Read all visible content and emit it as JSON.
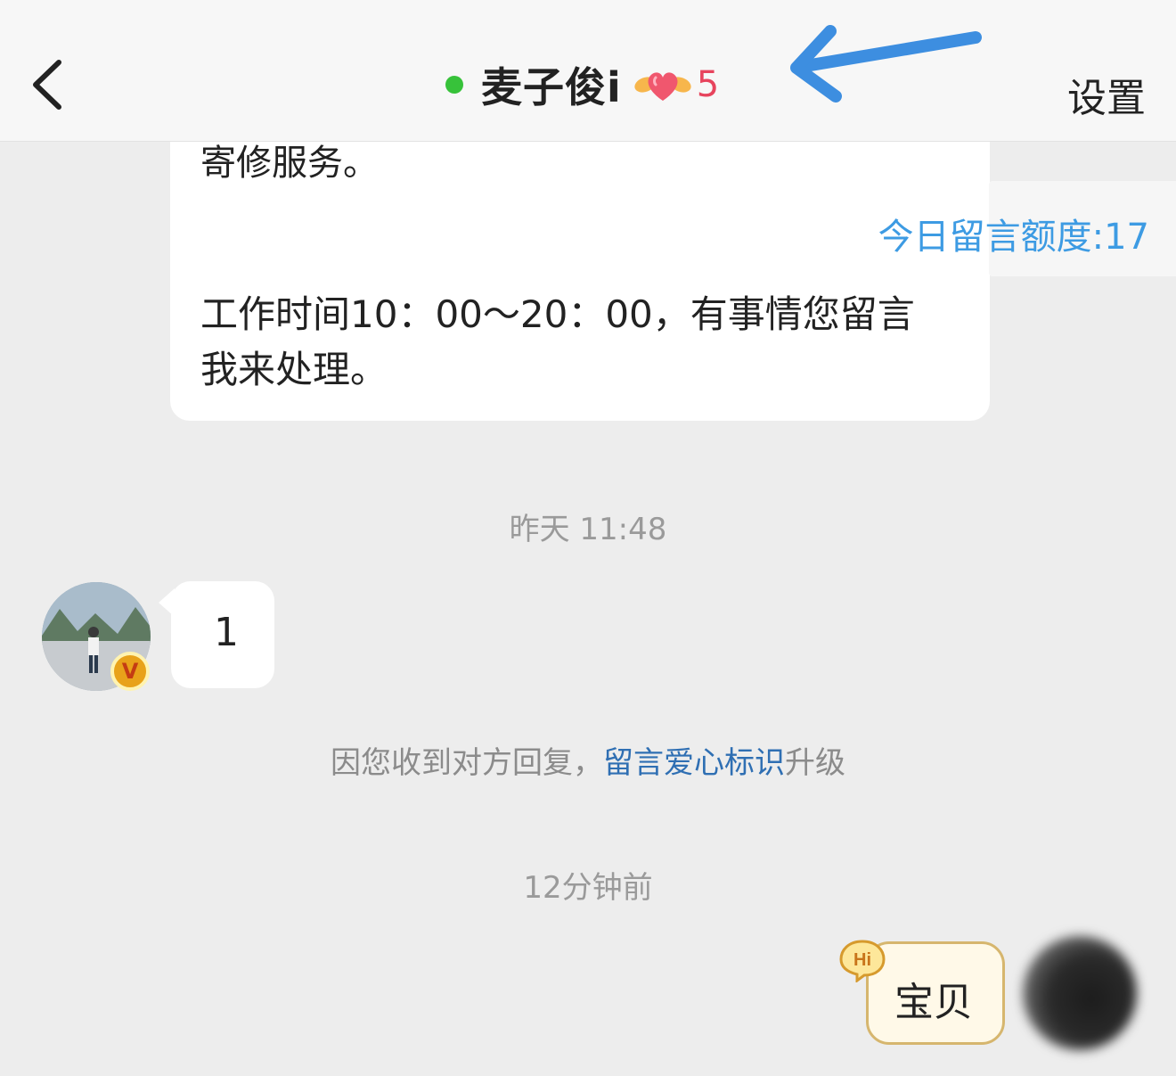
{
  "header": {
    "back_icon": "chevron-left-icon",
    "contact_name": "麦子俊i",
    "online_status_color": "#37c23a",
    "heart_icon": "winged-heart-icon",
    "heart_count": "5",
    "settings_label": "设置"
  },
  "annotation_arrow_color": "#3d8ee0",
  "message_card": {
    "partial_text": "寄修服务。",
    "body_text": "工作时间10：00～20：00，有事情您留言我来处理。"
  },
  "quota": {
    "text": "今日留言额度:17"
  },
  "timestamps": {
    "first": "昨天 11:48",
    "second": "12分钟前"
  },
  "incoming": {
    "avatar_icon": "user-avatar",
    "badge_icon": "vip-badge-icon",
    "message": "1"
  },
  "notice": {
    "prefix": "因您收到对方回复，",
    "link_text": "留言爱心标识",
    "suffix": "升级"
  },
  "outgoing": {
    "hi_badge": "Hi",
    "message": "宝贝",
    "avatar_icon": "blurred-avatar"
  }
}
